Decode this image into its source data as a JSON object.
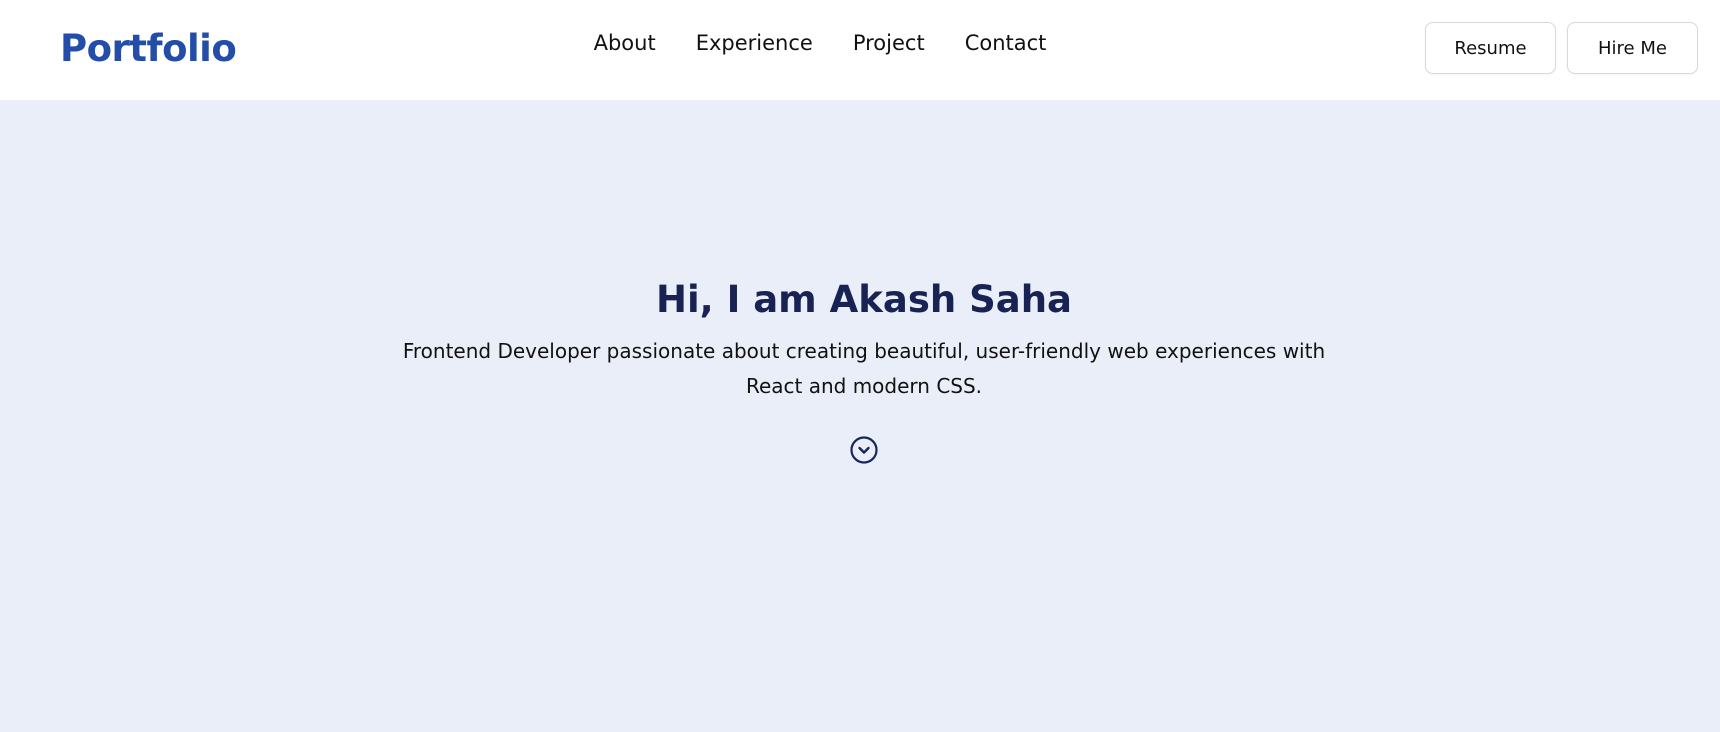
{
  "nav": {
    "brand": "Portfolio",
    "links": [
      "About",
      "Experience",
      "Project",
      "Contact"
    ],
    "resume_label": "Resume",
    "hire_label": "Hire Me"
  },
  "hero": {
    "title": "Hi, I am Akash Saha",
    "description": "Frontend Developer passionate about creating beautiful, user-friendly web experiences with React and modern CSS.",
    "scroll_icon": "chevron-down-circle-icon"
  },
  "colors": {
    "brand": "#234da8",
    "hero_background": "#eaeef8",
    "hero_title": "#182353",
    "icon": "#15255f"
  }
}
